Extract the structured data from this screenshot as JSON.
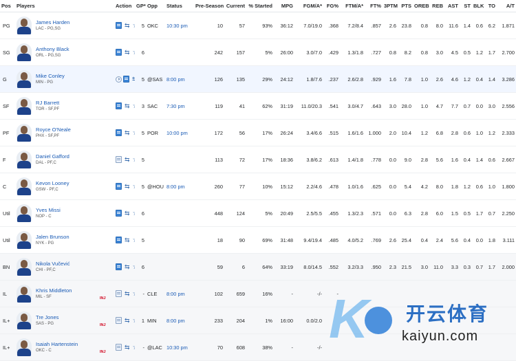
{
  "headers": {
    "pos": "Pos",
    "players": "Players",
    "action": "Action",
    "gp": "GP*",
    "opp": "Opp",
    "status": "Status",
    "preseason": "Pre-Season",
    "current": "Current",
    "started": "% Started",
    "mpg": "MPG",
    "fgm": "FGM/A*",
    "fgp": "FG%",
    "ftm": "FTM/A*",
    "ftp": "FT%",
    "tpm": "3PTM",
    "pts": "PTS",
    "oreb": "OREB",
    "reb": "REB",
    "ast": "AST",
    "st": "ST",
    "blk": "BLK",
    "to": "TO",
    "ato": "A/T"
  },
  "rows": [
    {
      "pos": "PG",
      "name": "James Harden",
      "team": "LAC - PG,SG",
      "inj": "",
      "gp": "5",
      "opp": "OKC",
      "status": "10:30 pm",
      "pre": "10",
      "cur": "57",
      "started": "93%",
      "mpg": "36:12",
      "fgm": "7.0/19.0",
      "fgp": ".368",
      "ftm": "7.2/8.4",
      "ftp": ".857",
      "tpm": "2.6",
      "pts": "23.8",
      "oreb": "0.8",
      "reb": "8.0",
      "ast": "11.6",
      "st": "1.4",
      "blk": "0.6",
      "to": "6.2",
      "ato": "1.871"
    },
    {
      "pos": "SG",
      "name": "Anthony Black",
      "team": "ORL - PG,SG",
      "inj": "",
      "gp": "6",
      "opp": "",
      "status": "",
      "pre": "242",
      "cur": "157",
      "started": "5%",
      "mpg": "26:00",
      "fgm": "3.0/7.0",
      "fgp": ".429",
      "ftm": "1.3/1.8",
      "ftp": ".727",
      "tpm": "0.8",
      "pts": "8.2",
      "oreb": "0.8",
      "reb": "3.0",
      "ast": "4.5",
      "st": "0.5",
      "blk": "1.2",
      "to": "1.7",
      "ato": "2.700"
    },
    {
      "pos": "G",
      "name": "Mike Conley",
      "team": "MIN - PG",
      "inj": "",
      "gp": "5",
      "opp": "@SAS",
      "status": "8:00 pm",
      "pre": "126",
      "cur": "135",
      "started": "29%",
      "mpg": "24:12",
      "fgm": "1.8/7.6",
      "fgp": ".237",
      "ftm": "2.6/2.8",
      "ftp": ".929",
      "tpm": "1.6",
      "pts": "7.8",
      "oreb": "1.0",
      "reb": "2.6",
      "ast": "4.6",
      "st": "1.2",
      "blk": "0.4",
      "to": "1.4",
      "ato": "3.286"
    },
    {
      "pos": "SF",
      "name": "RJ Barrett",
      "team": "TOR - SF,PF",
      "inj": "",
      "gp": "3",
      "opp": "SAC",
      "status": "7:30 pm",
      "pre": "119",
      "cur": "41",
      "started": "62%",
      "mpg": "31:19",
      "fgm": "11.0/20.3",
      "fgp": ".541",
      "ftm": "3.0/4.7",
      "ftp": ".643",
      "tpm": "3.0",
      "pts": "28.0",
      "oreb": "1.0",
      "reb": "4.7",
      "ast": "7.7",
      "st": "0.7",
      "blk": "0.0",
      "to": "3.0",
      "ato": "2.556"
    },
    {
      "pos": "PF",
      "name": "Royce O'Neale",
      "team": "PHX - SF,PF",
      "inj": "",
      "gp": "5",
      "opp": "POR",
      "status": "10:00 pm",
      "pre": "172",
      "cur": "56",
      "started": "17%",
      "mpg": "26:24",
      "fgm": "3.4/6.6",
      "fgp": ".515",
      "ftm": "1.6/1.6",
      "ftp": "1.000",
      "tpm": "2.0",
      "pts": "10.4",
      "oreb": "1.2",
      "reb": "6.8",
      "ast": "2.8",
      "st": "0.6",
      "blk": "1.0",
      "to": "1.2",
      "ato": "2.333"
    },
    {
      "pos": "F",
      "name": "Daniel Gafford",
      "team": "DAL - PF,C",
      "inj": "",
      "gp": "5",
      "opp": "",
      "status": "",
      "pre": "113",
      "cur": "72",
      "started": "17%",
      "mpg": "18:36",
      "fgm": "3.8/6.2",
      "fgp": ".613",
      "ftm": "1.4/1.8",
      "ftp": ".778",
      "tpm": "0.0",
      "pts": "9.0",
      "oreb": "2.8",
      "reb": "5.6",
      "ast": "1.6",
      "st": "0.4",
      "blk": "1.4",
      "to": "0.6",
      "ato": "2.667"
    },
    {
      "pos": "C",
      "name": "Kevon Looney",
      "team": "GSW - PF,C",
      "inj": "",
      "gp": "5",
      "opp": "@HOU",
      "status": "8:00 pm",
      "pre": "260",
      "cur": "77",
      "started": "10%",
      "mpg": "15:12",
      "fgm": "2.2/4.6",
      "fgp": ".478",
      "ftm": "1.0/1.6",
      "ftp": ".625",
      "tpm": "0.0",
      "pts": "5.4",
      "oreb": "4.2",
      "reb": "8.0",
      "ast": "1.8",
      "st": "1.2",
      "blk": "0.6",
      "to": "1.0",
      "ato": "1.800"
    },
    {
      "pos": "Util",
      "name": "Yves Missi",
      "team": "NOP - C",
      "inj": "",
      "gp": "6",
      "opp": "",
      "status": "",
      "pre": "448",
      "cur": "124",
      "started": "5%",
      "mpg": "20:49",
      "fgm": "2.5/5.5",
      "fgp": ".455",
      "ftm": "1.3/2.3",
      "ftp": ".571",
      "tpm": "0.0",
      "pts": "6.3",
      "oreb": "2.8",
      "reb": "6.0",
      "ast": "1.5",
      "st": "0.5",
      "blk": "1.7",
      "to": "0.7",
      "ato": "2.250"
    },
    {
      "pos": "Util",
      "name": "Jalen Brunson",
      "team": "NYK - PG",
      "inj": "",
      "gp": "5",
      "opp": "",
      "status": "",
      "pre": "18",
      "cur": "90",
      "started": "69%",
      "mpg": "31:48",
      "fgm": "9.4/19.4",
      "fgp": ".485",
      "ftm": "4.0/5.2",
      "ftp": ".769",
      "tpm": "2.6",
      "pts": "25.4",
      "oreb": "0.4",
      "reb": "2.4",
      "ast": "5.6",
      "st": "0.4",
      "blk": "0.0",
      "to": "1.8",
      "ato": "3.111"
    },
    {
      "pos": "BN",
      "name": "Nikola Vučević",
      "team": "CHI - PF,C",
      "inj": "",
      "gp": "6",
      "opp": "",
      "status": "",
      "pre": "59",
      "cur": "6",
      "started": "64%",
      "mpg": "33:19",
      "fgm": "8.0/14.5",
      "fgp": ".552",
      "ftm": "3.2/3.3",
      "ftp": ".950",
      "tpm": "2.3",
      "pts": "21.5",
      "oreb": "3.0",
      "reb": "11.0",
      "ast": "3.3",
      "st": "0.3",
      "blk": "0.7",
      "to": "1.7",
      "ato": "2.000"
    },
    {
      "pos": "IL",
      "name": "Khris Middleton",
      "team": "MIL - SF",
      "inj": "INJ",
      "gp": "-",
      "opp": "CLE",
      "status": "8:00 pm",
      "pre": "102",
      "cur": "659",
      "started": "16%",
      "mpg": "-",
      "fgm": "-/-",
      "fgp": "-",
      "ftm": "",
      "ftp": "",
      "tpm": "",
      "pts": "",
      "oreb": "",
      "reb": "",
      "ast": "",
      "st": "",
      "blk": "",
      "to": "",
      "ato": ""
    },
    {
      "pos": "IL+",
      "name": "Tre Jones",
      "team": "SAS - PG",
      "inj": "INJ",
      "gp": "1",
      "opp": "MIN",
      "status": "8:00 pm",
      "pre": "233",
      "cur": "204",
      "started": "1%",
      "mpg": "16:00",
      "fgm": "0.0/2.0",
      "fgp": "",
      "ftm": "",
      "ftp": "",
      "tpm": "",
      "pts": "",
      "oreb": "",
      "reb": "",
      "ast": "",
      "st": "",
      "blk": "",
      "to": "",
      "ato": ""
    },
    {
      "pos": "IL+",
      "name": "Isaiah Hartenstein",
      "team": "OKC - C",
      "inj": "INJ",
      "gp": "-",
      "opp": "@LAC",
      "status": "10:30 pm",
      "pre": "70",
      "cur": "608",
      "started": "38%",
      "mpg": "-",
      "fgm": "-/-",
      "fgp": "",
      "ftm": "",
      "ftp": "",
      "tpm": "",
      "pts": "",
      "oreb": "",
      "reb": "",
      "ast": "",
      "st": "",
      "blk": "",
      "to": "",
      "ato": ""
    }
  ],
  "watermark": {
    "cn": "开云体育",
    "en": "kaiyun.com"
  },
  "colors": {
    "link": "#1a5bb5",
    "injury": "#d0021b",
    "bench_bg": "#f6f7f9"
  }
}
